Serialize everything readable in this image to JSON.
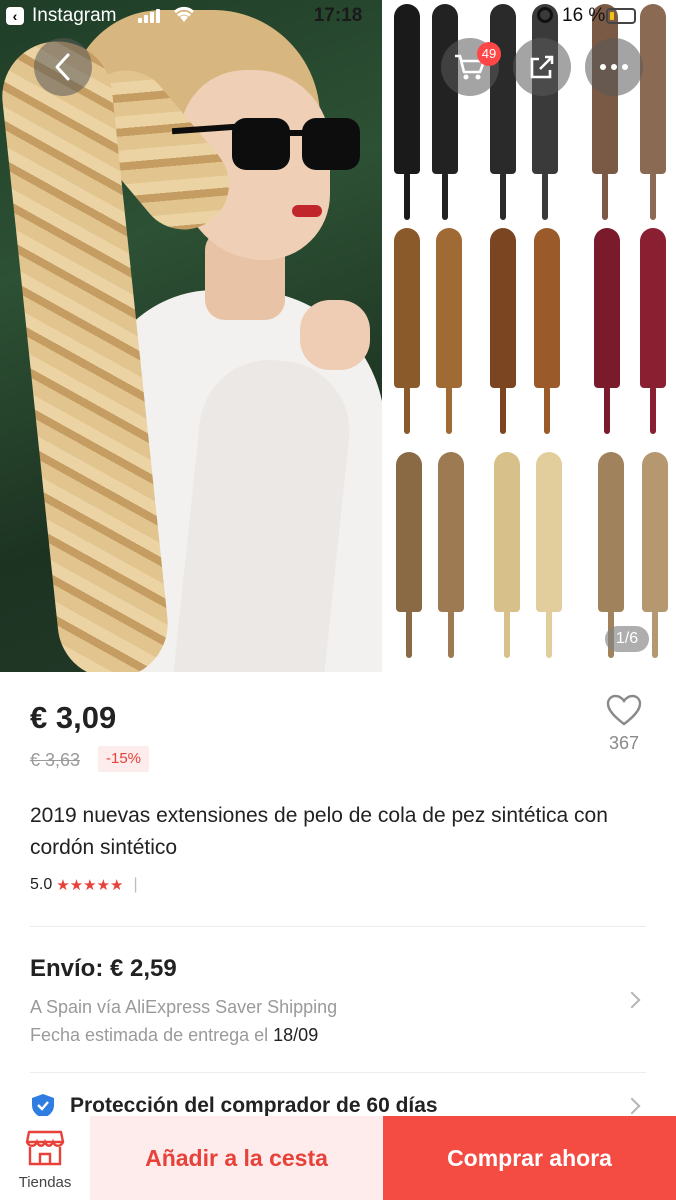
{
  "status_bar": {
    "app": "Instagram",
    "time": "17:18",
    "battery": "16 %",
    "battery_level": 0.16
  },
  "header": {
    "cart_count": "49",
    "image_counter": "1/6"
  },
  "product": {
    "price": "€ 3,09",
    "old_price": "€ 3,63",
    "discount": "-15%",
    "wishlist_count": "367",
    "title": "2019 nuevas extensiones de pelo de cola de pez sintética con cordón sintético",
    "rating": "5.0",
    "stars": "★★★★★",
    "rating_value": 5.0,
    "rating_separator": "|"
  },
  "shipping": {
    "title": "Envío: € 2,59",
    "method": "A Spain vía AliExpress Saver Shipping",
    "delivery_prefix": "Fecha estimada de entrega el ",
    "delivery_date": "18/09"
  },
  "protection": {
    "label": "Protección del comprador de 60 días"
  },
  "bottom_bar": {
    "stores_label": "Tiendas",
    "add_to_cart": "Añadir a la cesta",
    "buy_now": "Comprar ahora"
  },
  "colors": {
    "accent": "#f44b43",
    "accent_light": "#fdeceb",
    "discount_text": "#e8413a"
  }
}
